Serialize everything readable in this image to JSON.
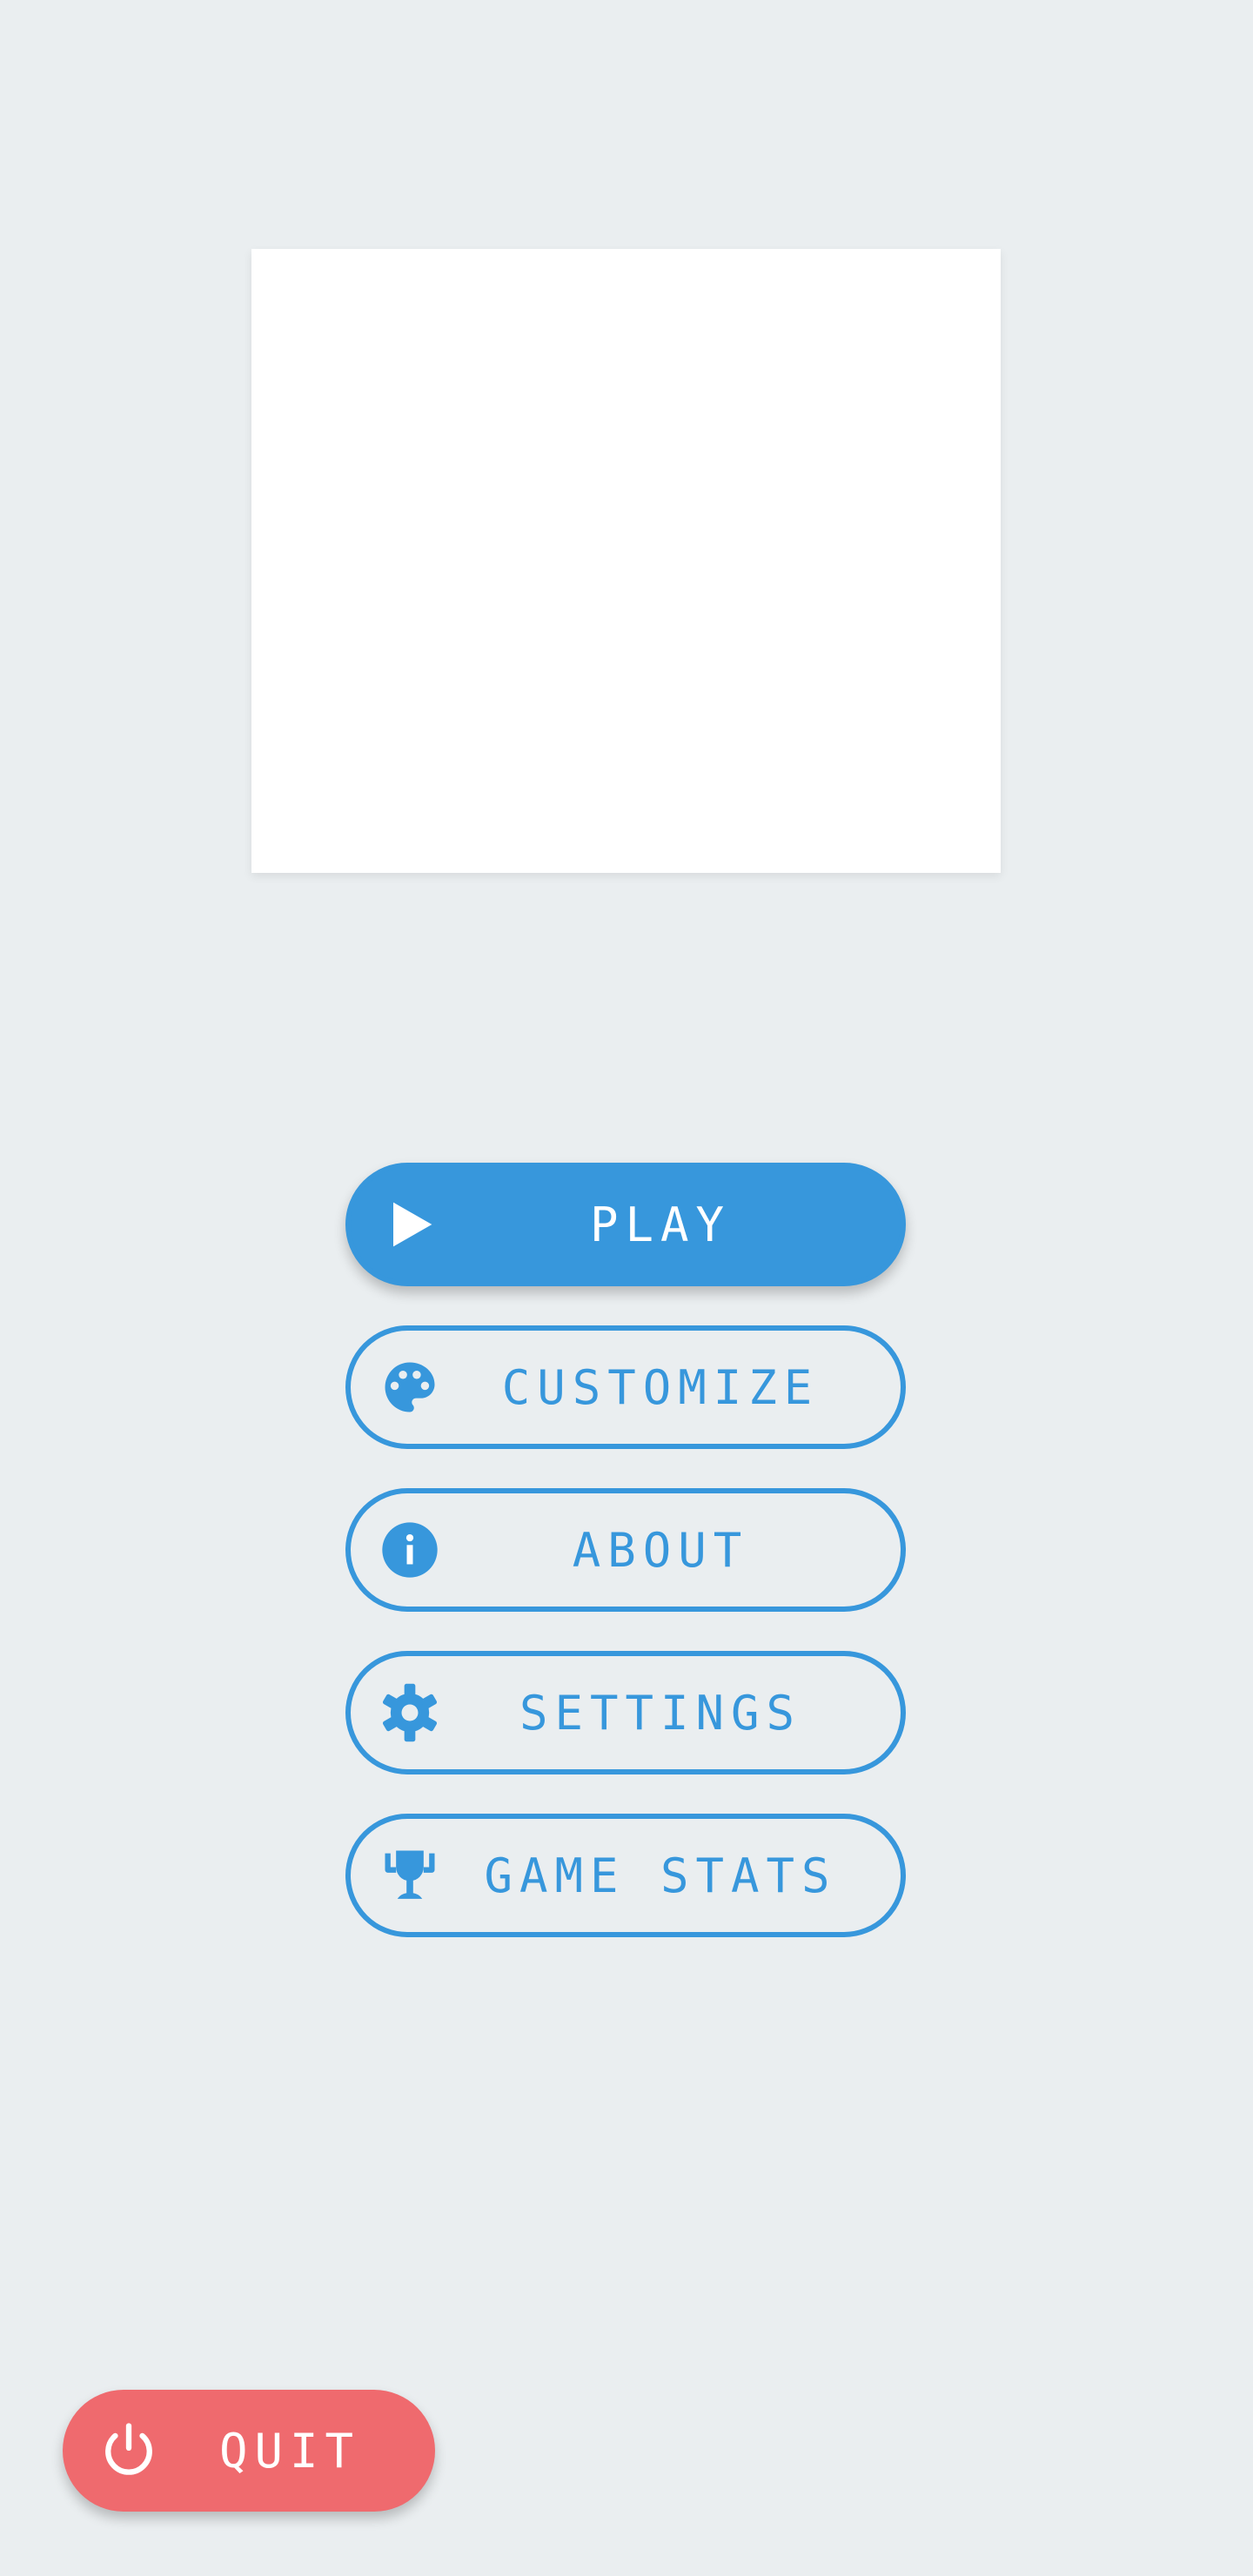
{
  "menu": {
    "buttons": [
      {
        "label": "PLAY",
        "icon": "play-icon",
        "style": "filled"
      },
      {
        "label": "CUSTOMIZE",
        "icon": "palette-icon",
        "style": "outline"
      },
      {
        "label": "ABOUT",
        "icon": "info-icon",
        "style": "outline"
      },
      {
        "label": "SETTINGS",
        "icon": "gear-icon",
        "style": "outline"
      },
      {
        "label": "GAME STATS",
        "icon": "trophy-icon",
        "style": "outline"
      }
    ]
  },
  "quit": {
    "label": "QUIT",
    "icon": "power-icon"
  },
  "colors": {
    "background": "#eaeef0",
    "primary": "#3797dc",
    "quit": "#ef6a6e",
    "panel": "#ffffff"
  }
}
